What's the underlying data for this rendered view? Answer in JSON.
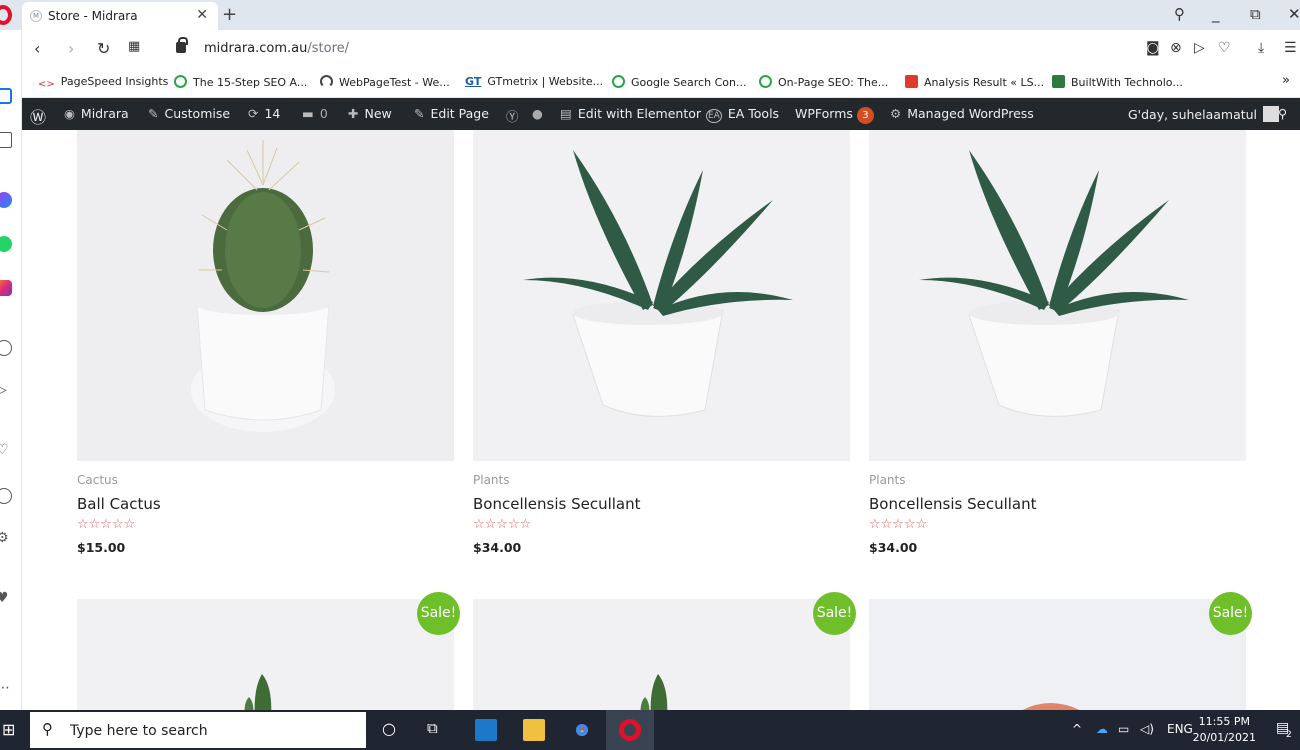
{
  "browser": {
    "tab_title": "Store - Midrara",
    "tab_favicon_letter": "M",
    "url_domain": "midrara.com.au",
    "url_path": "/store/",
    "bookmarks": [
      "PageSpeed Insights",
      "The 15-Step SEO A...",
      "WebPageTest - We...",
      "GTmetrix | Website...",
      "Google Search Con...",
      "On-Page SEO: The...",
      "Analysis Result « LS...",
      "BuiltWith Technolo..."
    ],
    "gt_label": "GT",
    "more": "»"
  },
  "wp_admin": {
    "site": "Midrara",
    "customise": "Customise",
    "updates": "14",
    "comments": "0",
    "new": "New",
    "edit_page": "Edit Page",
    "elementor": "Edit with Elementor",
    "ea_tools": "EA Tools",
    "ea_icon_text": "EA",
    "wpforms": "WPForms",
    "wpforms_badge": "3",
    "managed": "Managed WordPress",
    "greeting": "G'day, suhelaamatul"
  },
  "products": [
    {
      "category": "Cactus",
      "name": "Ball Cactus",
      "price": "$15.00",
      "rating": 0
    },
    {
      "category": "Plants",
      "name": "Boncellensis Secullant",
      "price": "$34.00",
      "rating": 0
    },
    {
      "category": "Plants",
      "name": "Boncellensis Secullant",
      "price": "$34.00",
      "rating": 0
    }
  ],
  "stars": "☆☆☆☆☆",
  "sale_label": "Sale!",
  "taskbar": {
    "search_placeholder": "Type here to search",
    "lang": "ENG",
    "time": "11:55 PM",
    "date": "20/01/2021",
    "notif_count": "2"
  },
  "colors": {
    "wp_bar": "#23282d",
    "sale_badge": "#6fbf2a",
    "star": "#e35e5e",
    "taskbar": "#1f2631"
  }
}
